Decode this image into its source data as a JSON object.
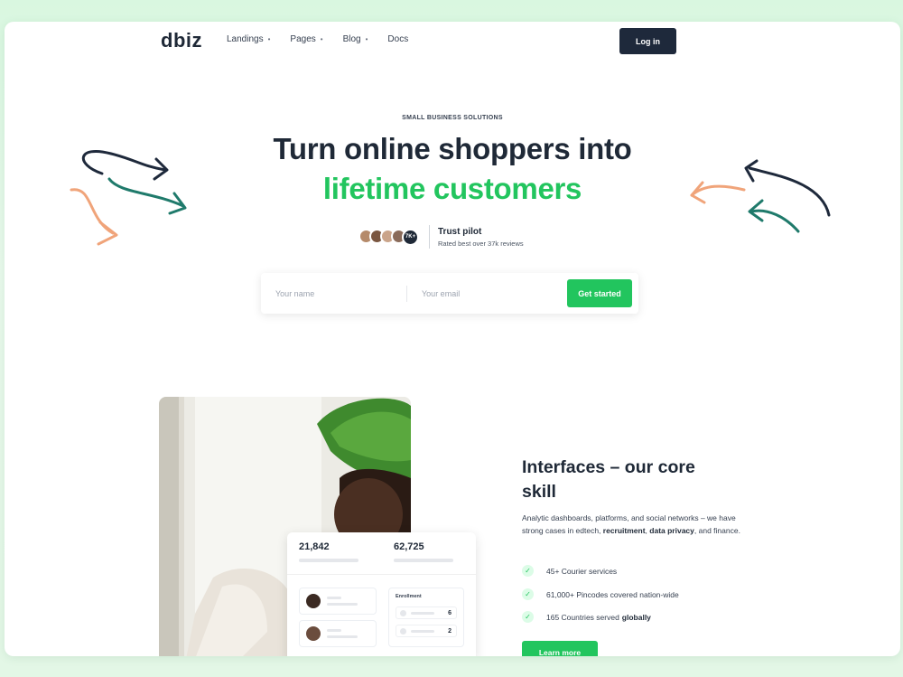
{
  "nav": {
    "logo": "dbiz",
    "menu": [
      {
        "label": "Landings",
        "has_dropdown": true
      },
      {
        "label": "Pages",
        "has_dropdown": true
      },
      {
        "label": "Blog",
        "has_dropdown": true
      },
      {
        "label": "Docs",
        "has_dropdown": false
      }
    ],
    "login_label": "Log in"
  },
  "hero": {
    "eyebrow": "SMALL BUSINESS SOLUTIONS",
    "title_line1": "Turn online shoppers into",
    "title_line2": "lifetime customers",
    "avatar_count": "7K+",
    "trust_title": "Trust pilot",
    "trust_subtitle": "Rated best over 37k reviews"
  },
  "signup_form": {
    "name_placeholder": "Your name",
    "email_placeholder": "Your email",
    "button_label": "Get started"
  },
  "dashboard_card": {
    "stat1": "21,842",
    "stat2": "62,725",
    "enrollment_label": "Enrollment",
    "enrollment_values": [
      "6",
      "2"
    ]
  },
  "feature_section": {
    "title": "Interfaces – our core skill",
    "desc_intro": "Analytic dashboards, platforms, and social networks – we have strong cases in edtech, ",
    "desc_bold1": "recruitment",
    "desc_sep": ", ",
    "desc_bold2": "data privacy",
    "desc_end": ", and finance.",
    "features": [
      {
        "text": "45+ Courier services",
        "bold": ""
      },
      {
        "text": "61,000+ Pincodes covered nation-wide",
        "bold": ""
      },
      {
        "text": "165 Countries served",
        "bold": "globally"
      }
    ],
    "learn_more_label": "Learn more"
  },
  "colors": {
    "accent_green": "#22c55e",
    "dark_navy": "#1e293b",
    "arrow_teal": "#1f7a6b",
    "arrow_orange": "#f0a47a"
  }
}
